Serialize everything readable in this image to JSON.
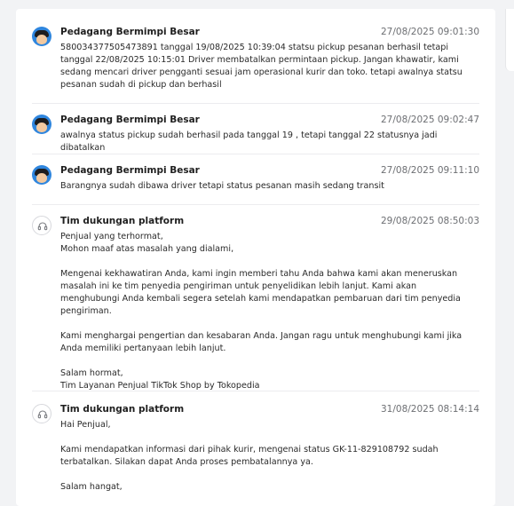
{
  "messages": [
    {
      "sender": "Pedagang Bermimpi Besar",
      "avatar": "user-avatar",
      "timestamp": "27/08/2025 09:01:30",
      "text": "580034377505473891 tanggal 19/08/2025 10:39:04 statsu pickup pesanan berhasil tetapi tanggal 22/08/2025 10:15:01 Driver membatalkan permintaan pickup. Jangan khawatir, kami sedang mencari driver pengganti sesuai jam operasional kurir dan toko. tetapi awalnya statsu pesanan sudah di pickup dan berhasil"
    },
    {
      "sender": "Pedagang Bermimpi Besar",
      "avatar": "user-avatar",
      "timestamp": "27/08/2025 09:02:47",
      "text": "awalnya status pickup sudah berhasil pada tanggal 19 , tetapi tanggal 22 statusnya jadi dibatalkan"
    },
    {
      "sender": "Pedagang Bermimpi Besar",
      "avatar": "user-avatar",
      "timestamp": "27/08/2025 09:11:10",
      "text": "Barangnya sudah dibawa driver tetapi status pesanan masih sedang transit"
    },
    {
      "sender": "Tim dukungan platform",
      "avatar": "headset-icon",
      "timestamp": "29/08/2025 08:50:03",
      "text": "Penjual yang terhormat,\nMohon maaf atas masalah yang dialami,\n\nMengenai kekhawatiran Anda, kami ingin memberi tahu Anda bahwa kami akan meneruskan masalah ini ke tim penyedia pengiriman untuk penyelidikan lebih lanjut. Kami akan menghubungi Anda kembali segera setelah kami mendapatkan pembaruan dari tim penyedia pengiriman.\n\nKami menghargai pengertian dan kesabaran Anda. Jangan ragu untuk menghubungi kami jika Anda memiliki pertanyaan lebih lanjut.\n\nSalam hormat,\nTim Layanan Penjual TikTok Shop by Tokopedia"
    },
    {
      "sender": "Tim dukungan platform",
      "avatar": "headset-icon",
      "timestamp": "31/08/2025 08:14:14",
      "text": "Hai Penjual,\n\nKami mendapatkan informasi dari pihak kurir, mengenai status GK-11-829108792 sudah terbatalkan. Silakan dapat Anda proses pembatalannya ya.\n\nSalam hangat,"
    }
  ]
}
